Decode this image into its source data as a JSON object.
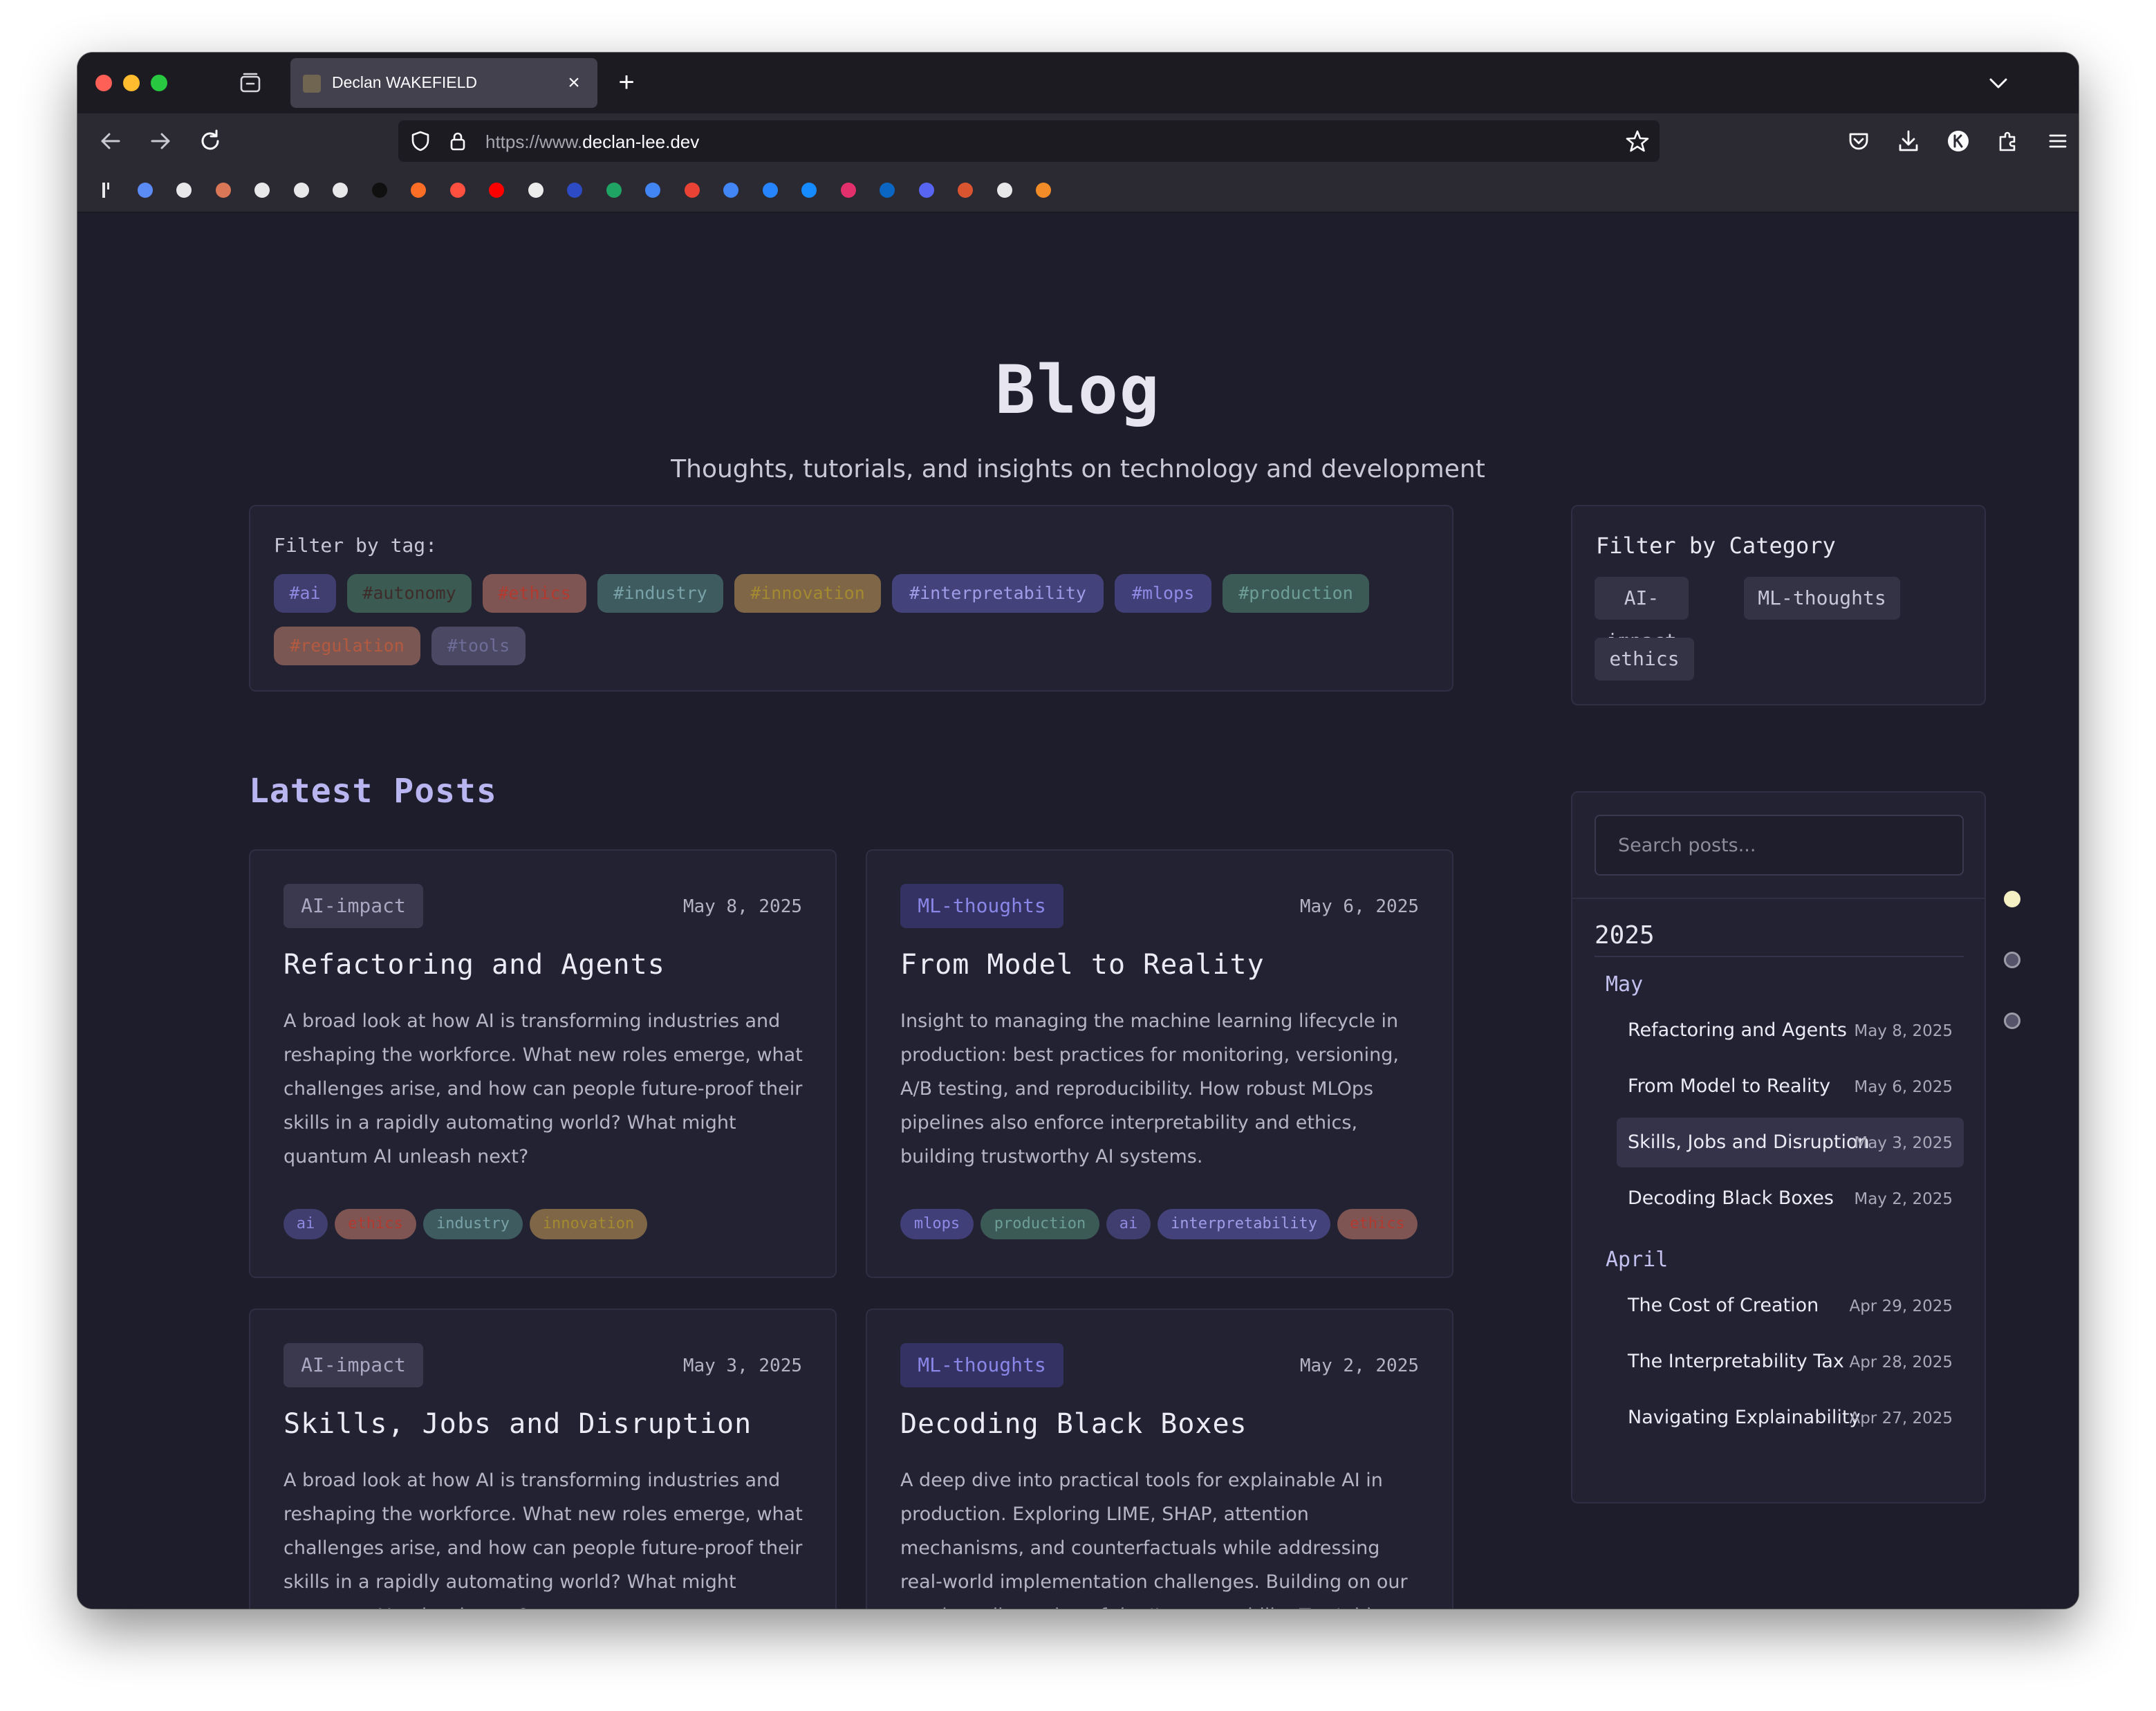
{
  "browser": {
    "tab_title": "Declan WAKEFIELD",
    "tab_close": "×",
    "new_tab": "+",
    "url_scheme": "https://www.",
    "url_domain": "declan-lee.dev"
  },
  "bookmarks": [
    {
      "icon": "bookmark-bar-icon",
      "color": "#e8e8ea"
    },
    {
      "icon": "gemini-icon",
      "color": "#5b8cf5"
    },
    {
      "icon": "perplexity-icon",
      "color": "#e8e8ea"
    },
    {
      "icon": "claude-icon",
      "color": "#d97757"
    },
    {
      "icon": "x-icon",
      "color": "#e8e8ea"
    },
    {
      "icon": "openai-icon",
      "color": "#e8e8ea"
    },
    {
      "icon": "cube-icon",
      "color": "#e8e8ea"
    },
    {
      "icon": "github-icon",
      "color": "#101010"
    },
    {
      "icon": "gitlab-icon",
      "color": "#fc6d26"
    },
    {
      "icon": "hacker-news-icon",
      "color": "#ff4f3f"
    },
    {
      "icon": "youtube-icon",
      "color": "#ff0000"
    },
    {
      "icon": "papers-icon",
      "color": "#ececec"
    },
    {
      "icon": "medium-icon",
      "color": "#2c4bc4"
    },
    {
      "icon": "google-drive-icon",
      "color": "#1fa463"
    },
    {
      "icon": "google-calendar-icon",
      "color": "#4285f4"
    },
    {
      "icon": "gmail-icon",
      "color": "#ea4335"
    },
    {
      "icon": "google-docs-icon",
      "color": "#4285f4"
    },
    {
      "icon": "jira-icon",
      "color": "#2684ff"
    },
    {
      "icon": "messenger-icon",
      "color": "#168aff"
    },
    {
      "icon": "instagram-icon",
      "color": "#e1306c"
    },
    {
      "icon": "linkedin-icon",
      "color": "#0a66c2"
    },
    {
      "icon": "discord-icon",
      "color": "#5865f2"
    },
    {
      "icon": "product-hunt-icon",
      "color": "#da552f"
    },
    {
      "icon": "globe-icon",
      "color": "#e8e8ea"
    },
    {
      "icon": "package-icon",
      "color": "#f28c28"
    }
  ],
  "header": {
    "title": "Blog",
    "subtitle": "Thoughts, tutorials, and insights on technology and development"
  },
  "tag_filter": {
    "label": "Filter by tag:",
    "tags": [
      {
        "label": "#ai",
        "bg": "#403e6e",
        "fg": "#8e8ae0"
      },
      {
        "label": "#autonomy",
        "bg": "#3a5a52",
        "fg": "#3e2c2a"
      },
      {
        "label": "#ethics",
        "bg": "#7e5552",
        "fg": "#b33a30"
      },
      {
        "label": "#industry",
        "bg": "#3e5c60",
        "fg": "#79a2a8"
      },
      {
        "label": "#innovation",
        "bg": "#7e6646",
        "fg": "#a48a30"
      },
      {
        "label": "#interpretability",
        "bg": "#44427a",
        "fg": "#a09ce8"
      },
      {
        "label": "#mlops",
        "bg": "#413f78",
        "fg": "#8f8be6"
      },
      {
        "label": "#production",
        "bg": "#3c5a55",
        "fg": "#6d9e96"
      },
      {
        "label": "#regulation",
        "bg": "#7a5752",
        "fg": "#b45a40"
      },
      {
        "label": "#tools",
        "bg": "#4a4863",
        "fg": "#6f6c98"
      }
    ]
  },
  "latest_heading": "Latest Posts",
  "posts": [
    {
      "category": "AI-impact",
      "date": "May 8, 2025",
      "title": "Refactoring and Agents",
      "description": "A broad look at how AI is transforming industries and reshaping the workforce. What new roles emerge, what challenges arise, and how can people future-proof their skills in a rapidly automating world? What might quantum AI unleash next?",
      "tags": [
        {
          "label": "ai",
          "bg": "#403e6e",
          "fg": "#8e8ae0"
        },
        {
          "label": "ethics",
          "bg": "#7e5552",
          "fg": "#b33a30"
        },
        {
          "label": "industry",
          "bg": "#3e5c60",
          "fg": "#79a2a8"
        },
        {
          "label": "innovation",
          "bg": "#7e6646",
          "fg": "#a48a30"
        }
      ]
    },
    {
      "category": "ML-thoughts",
      "date": "May 6, 2025",
      "title": "From Model to Reality",
      "description": "Insight to managing the machine learning lifecycle in production: best practices for monitoring, versioning, A/B testing, and reproducibility. How robust MLOps pipelines also enforce interpretability and ethics, building trustworthy AI systems.",
      "tags": [
        {
          "label": "mlops",
          "bg": "#413f78",
          "fg": "#8f8be6"
        },
        {
          "label": "production",
          "bg": "#3c5a55",
          "fg": "#6d9e96"
        },
        {
          "label": "ai",
          "bg": "#403e6e",
          "fg": "#8e8ae0"
        },
        {
          "label": "interpretability",
          "bg": "#44427a",
          "fg": "#a09ce8"
        },
        {
          "label": "ethics",
          "bg": "#7e5552",
          "fg": "#b33a30"
        }
      ]
    },
    {
      "category": "AI-impact",
      "date": "May 3, 2025",
      "title": "Skills, Jobs and Disruption",
      "description": "A broad look at how AI is transforming industries and reshaping the workforce. What new roles emerge, what challenges arise, and how can people future-proof their skills in a rapidly automating world? What might quantum AI unleash next?",
      "tags": []
    },
    {
      "category": "ML-thoughts",
      "date": "May 2, 2025",
      "title": "Decoding Black Boxes",
      "description": "A deep dive into practical tools for explainable AI in production. Exploring LIME, SHAP, attention mechanisms, and counterfactuals while addressing real-world implementation challenges. Building on our previous discussion of the 'Interpretability Tax,' this post quantifies the costs and benefits of explainability across different",
      "tags": []
    }
  ],
  "category_filter": {
    "title": "Filter by Category",
    "categories": [
      "AI-impact",
      "ML-thoughts",
      "ethics"
    ]
  },
  "archive": {
    "search_placeholder": "Search posts...",
    "year": "2025",
    "months": [
      {
        "name": "May",
        "posts": [
          {
            "title": "Refactoring and Agents",
            "date": "May 8, 2025",
            "active": false
          },
          {
            "title": "From Model to Reality",
            "date": "May 6, 2025",
            "active": false
          },
          {
            "title": "Skills, Jobs and Disruption",
            "date": "May 3, 2025",
            "active": true
          },
          {
            "title": "Decoding Black Boxes",
            "date": "May 2, 2025",
            "active": false
          }
        ]
      },
      {
        "name": "April",
        "posts": [
          {
            "title": "The Cost of Creation",
            "date": "Apr 29, 2025",
            "active": false
          },
          {
            "title": "The Interpretability Tax",
            "date": "Apr 28, 2025",
            "active": false
          },
          {
            "title": "Navigating Explainability",
            "date": "Apr 27, 2025",
            "active": false
          }
        ]
      }
    ]
  }
}
